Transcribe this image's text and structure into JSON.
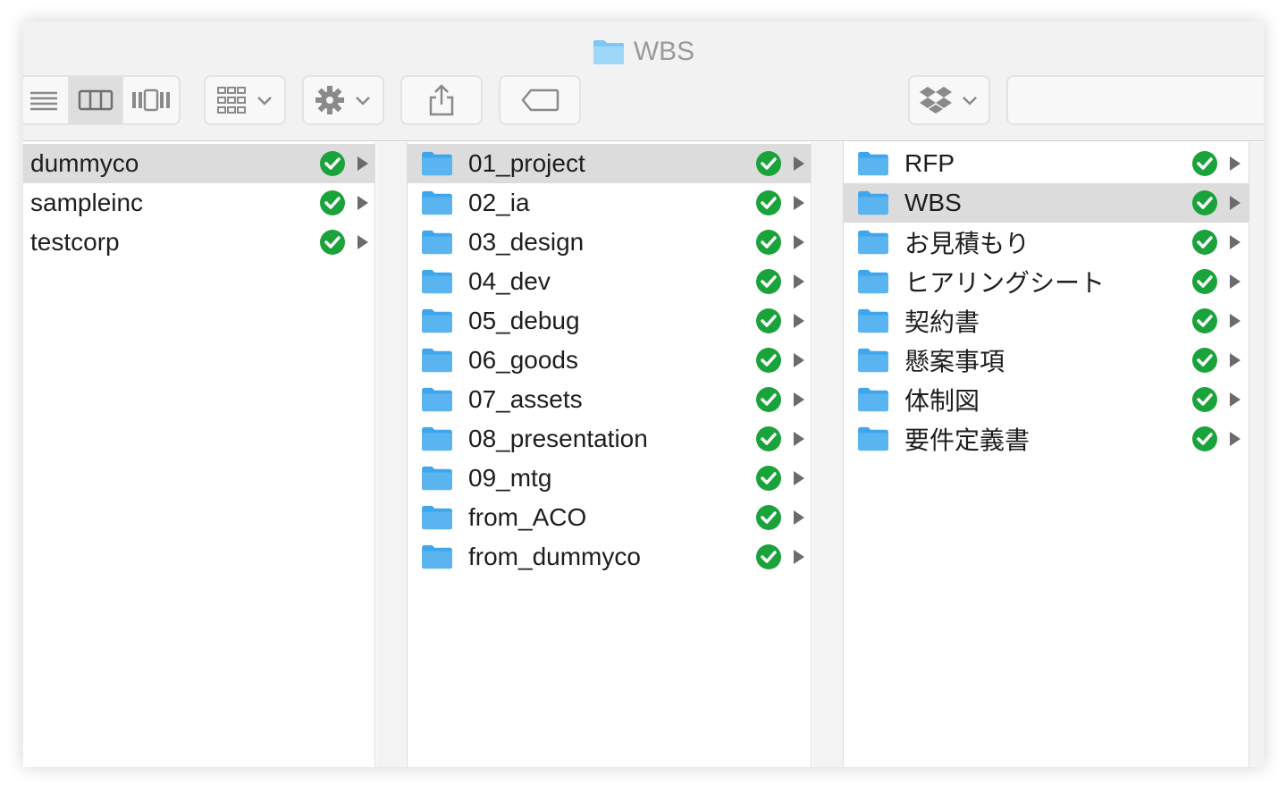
{
  "window": {
    "title": "WBS"
  },
  "colors": {
    "accent_green": "#1aa23b",
    "folder_blue": "#5ab4ef",
    "selection": "#dcdcdc"
  },
  "toolbar": {
    "view_buttons": [
      "list-view-icon",
      "column-view-icon",
      "cover-flow-icon"
    ],
    "selected_view": "column-view-icon",
    "group_button": "group-icon",
    "action_button": "gear-icon",
    "share_button": "share-icon",
    "tag_button": "tag-icon",
    "dropbox_button": "dropbox-icon",
    "search_value": ""
  },
  "columns": [
    {
      "items": [
        {
          "label": "dummyco",
          "selected": true
        },
        {
          "label": "sampleinc",
          "selected": false
        },
        {
          "label": "testcorp",
          "selected": false
        }
      ]
    },
    {
      "items": [
        {
          "label": "01_project",
          "selected": true
        },
        {
          "label": "02_ia",
          "selected": false
        },
        {
          "label": "03_design",
          "selected": false
        },
        {
          "label": "04_dev",
          "selected": false
        },
        {
          "label": "05_debug",
          "selected": false
        },
        {
          "label": "06_goods",
          "selected": false
        },
        {
          "label": "07_assets",
          "selected": false
        },
        {
          "label": "08_presentation",
          "selected": false
        },
        {
          "label": "09_mtg",
          "selected": false
        },
        {
          "label": "from_ACO",
          "selected": false
        },
        {
          "label": "from_dummyco",
          "selected": false
        }
      ]
    },
    {
      "items": [
        {
          "label": "RFP",
          "selected": false
        },
        {
          "label": "WBS",
          "selected": true
        },
        {
          "label": "お見積もり",
          "selected": false
        },
        {
          "label": "ヒアリングシート",
          "selected": false
        },
        {
          "label": "契約書",
          "selected": false
        },
        {
          "label": "懸案事項",
          "selected": false
        },
        {
          "label": "体制図",
          "selected": false
        },
        {
          "label": "要件定義書",
          "selected": false
        }
      ]
    }
  ]
}
